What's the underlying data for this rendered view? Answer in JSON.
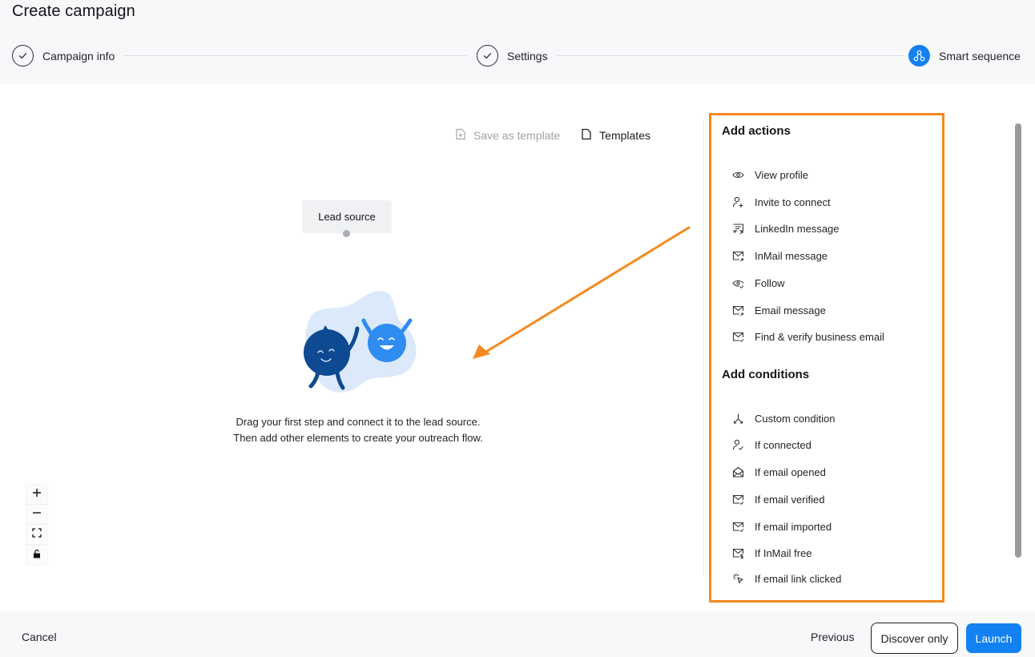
{
  "header": {
    "title": "Create campaign",
    "steps": [
      {
        "label": "Campaign info",
        "status": "completed",
        "icon": "check-icon"
      },
      {
        "label": "Settings",
        "status": "completed",
        "icon": "check-icon"
      },
      {
        "label": "Smart sequence",
        "status": "active",
        "icon": "sequence-icon"
      }
    ],
    "accent_color": "#1481f2"
  },
  "canvas": {
    "save_template_label": "Save as template",
    "templates_label": "Templates",
    "lead_source_label": "Lead source",
    "empty_state_text": "Drag your first step and connect it to the lead source. Then add other elements to create your outreach flow.",
    "zoom_controls": [
      {
        "name": "zoom-in",
        "icon": "plus-icon"
      },
      {
        "name": "zoom-out",
        "icon": "minus-icon"
      },
      {
        "name": "fit-view",
        "icon": "fit-view-icon"
      },
      {
        "name": "lock",
        "icon": "lock-icon"
      }
    ]
  },
  "panel": {
    "actions_title": "Add actions",
    "actions": [
      {
        "label": "View profile",
        "icon": "eye-icon"
      },
      {
        "label": "Invite to connect",
        "icon": "user-plus-icon"
      },
      {
        "label": "LinkedIn message",
        "icon": "message-icon"
      },
      {
        "label": "InMail message",
        "icon": "mail-send-icon"
      },
      {
        "label": "Follow",
        "icon": "eye-check-icon"
      },
      {
        "label": "Email message",
        "icon": "mail-send-icon"
      },
      {
        "label": "Find & verify business email",
        "icon": "mail-check-icon"
      }
    ],
    "conditions_title": "Add conditions",
    "conditions": [
      {
        "label": "Custom condition",
        "icon": "split-icon"
      },
      {
        "label": "If connected",
        "icon": "user-check-icon"
      },
      {
        "label": "If email opened",
        "icon": "mail-open-icon"
      },
      {
        "label": "If email verified",
        "icon": "mail-check-icon"
      },
      {
        "label": "If email imported",
        "icon": "mail-check-icon"
      },
      {
        "label": "If InMail free",
        "icon": "mail-dollar-icon"
      },
      {
        "label": "If email link clicked",
        "icon": "click-icon"
      }
    ],
    "highlight_color": "#f5891f"
  },
  "footer": {
    "cancel_label": "Cancel",
    "previous_label": "Previous",
    "discover_label": "Discover only",
    "launch_label": "Launch"
  }
}
